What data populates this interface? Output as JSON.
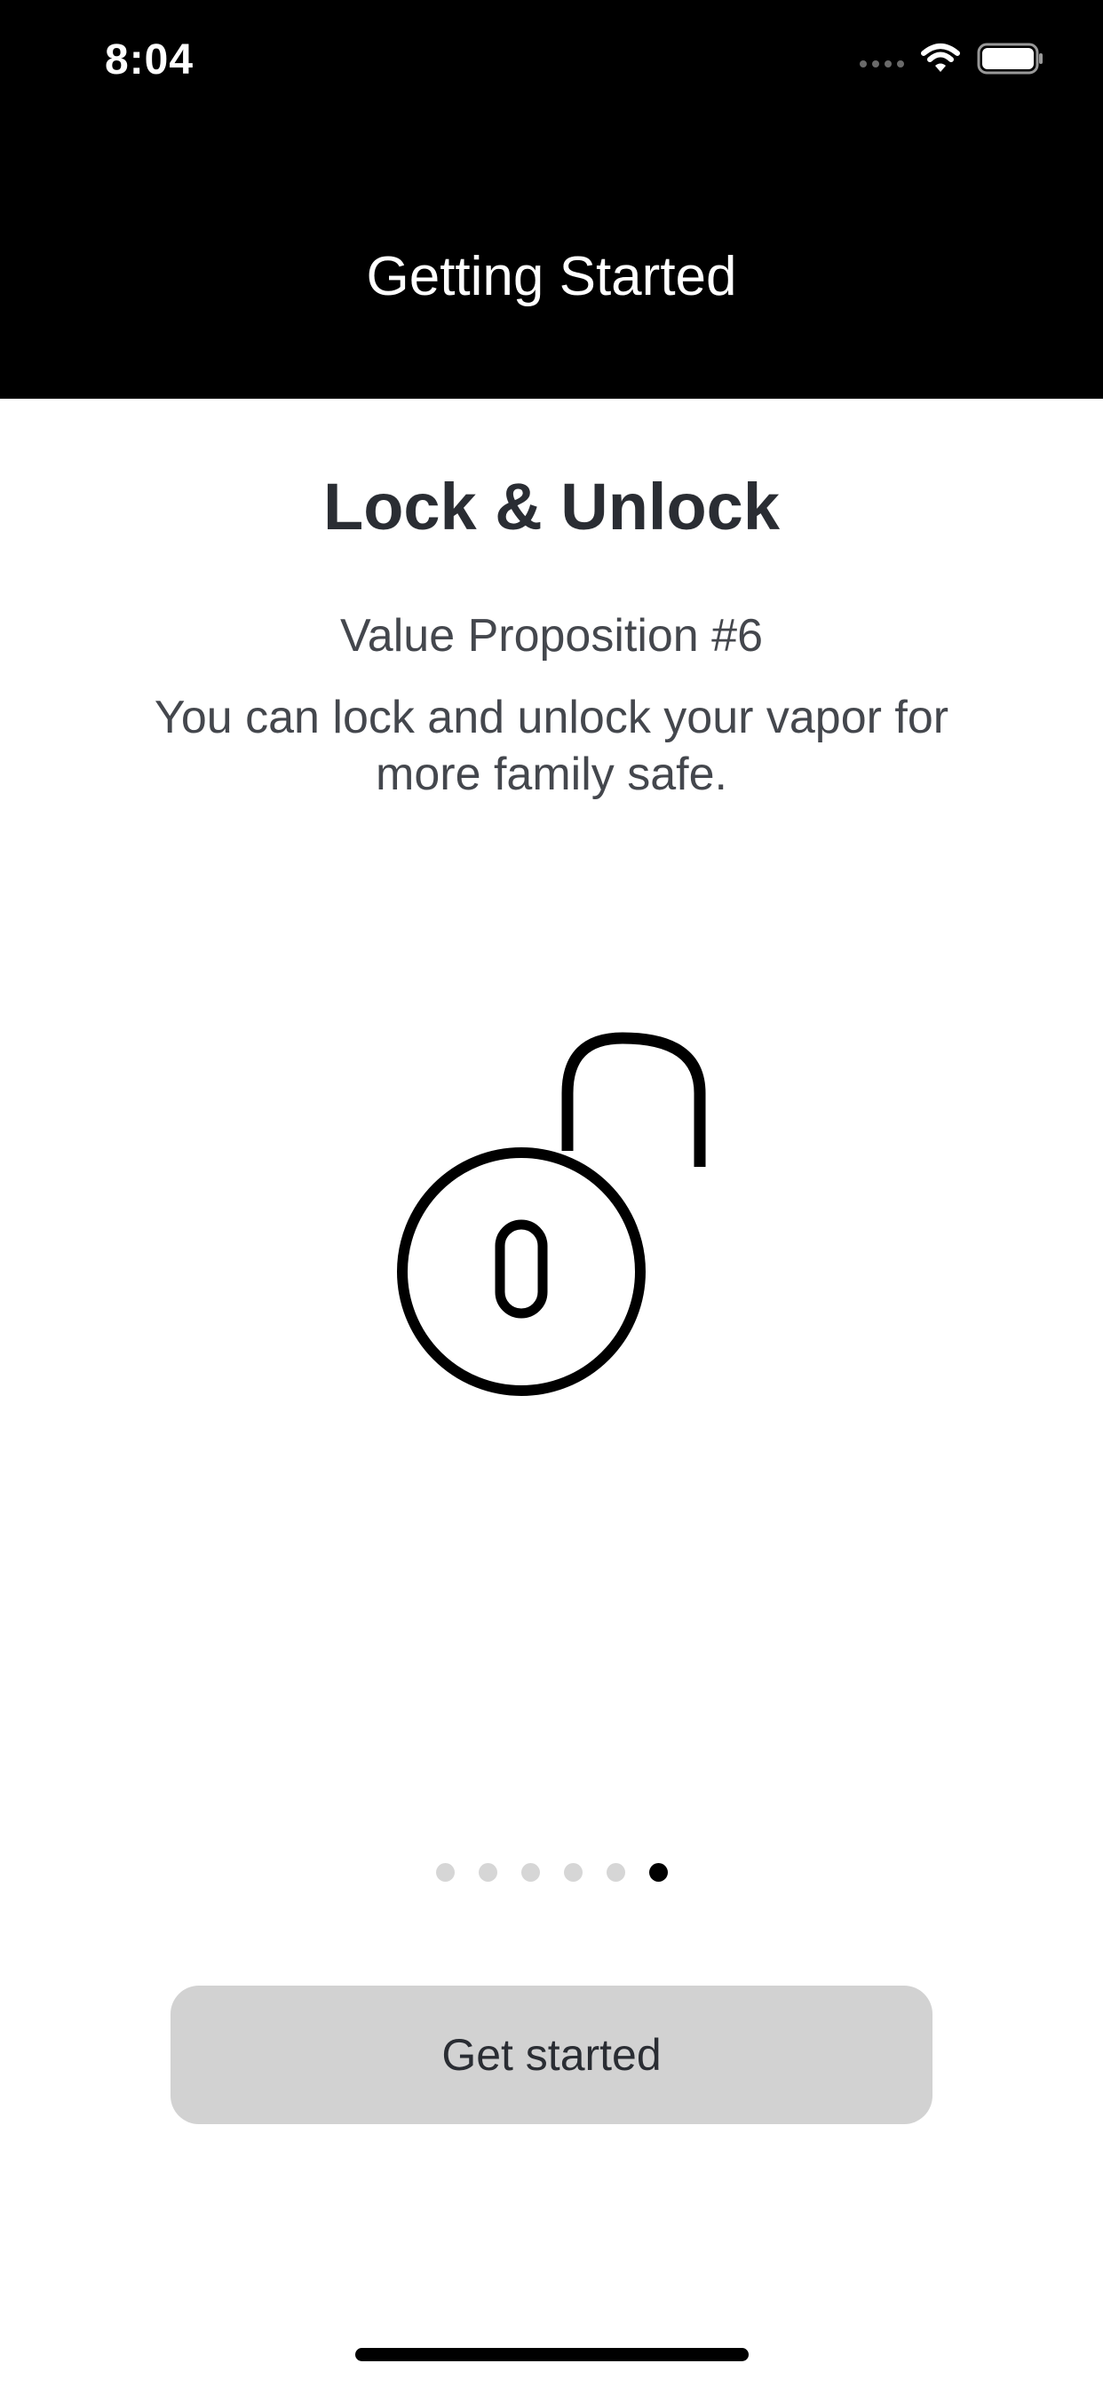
{
  "status_bar": {
    "time": "8:04"
  },
  "nav": {
    "title": "Getting Started"
  },
  "content": {
    "title": "Lock & Unlock",
    "subtitle": "Value Proposition #6",
    "description": "You can lock and unlock your vapor for more family safe.",
    "illustration_icon": "unlocked-padlock-icon"
  },
  "pager": {
    "total_pages": 6,
    "current_page": 6
  },
  "actions": {
    "get_started_label": "Get started"
  },
  "colors": {
    "header_background": "#000000",
    "text_dark": "#2a2d33",
    "text_body": "#44474d",
    "button_background": "#d2d2d2",
    "dot_inactive": "#d6d6d6",
    "dot_active": "#000000"
  }
}
